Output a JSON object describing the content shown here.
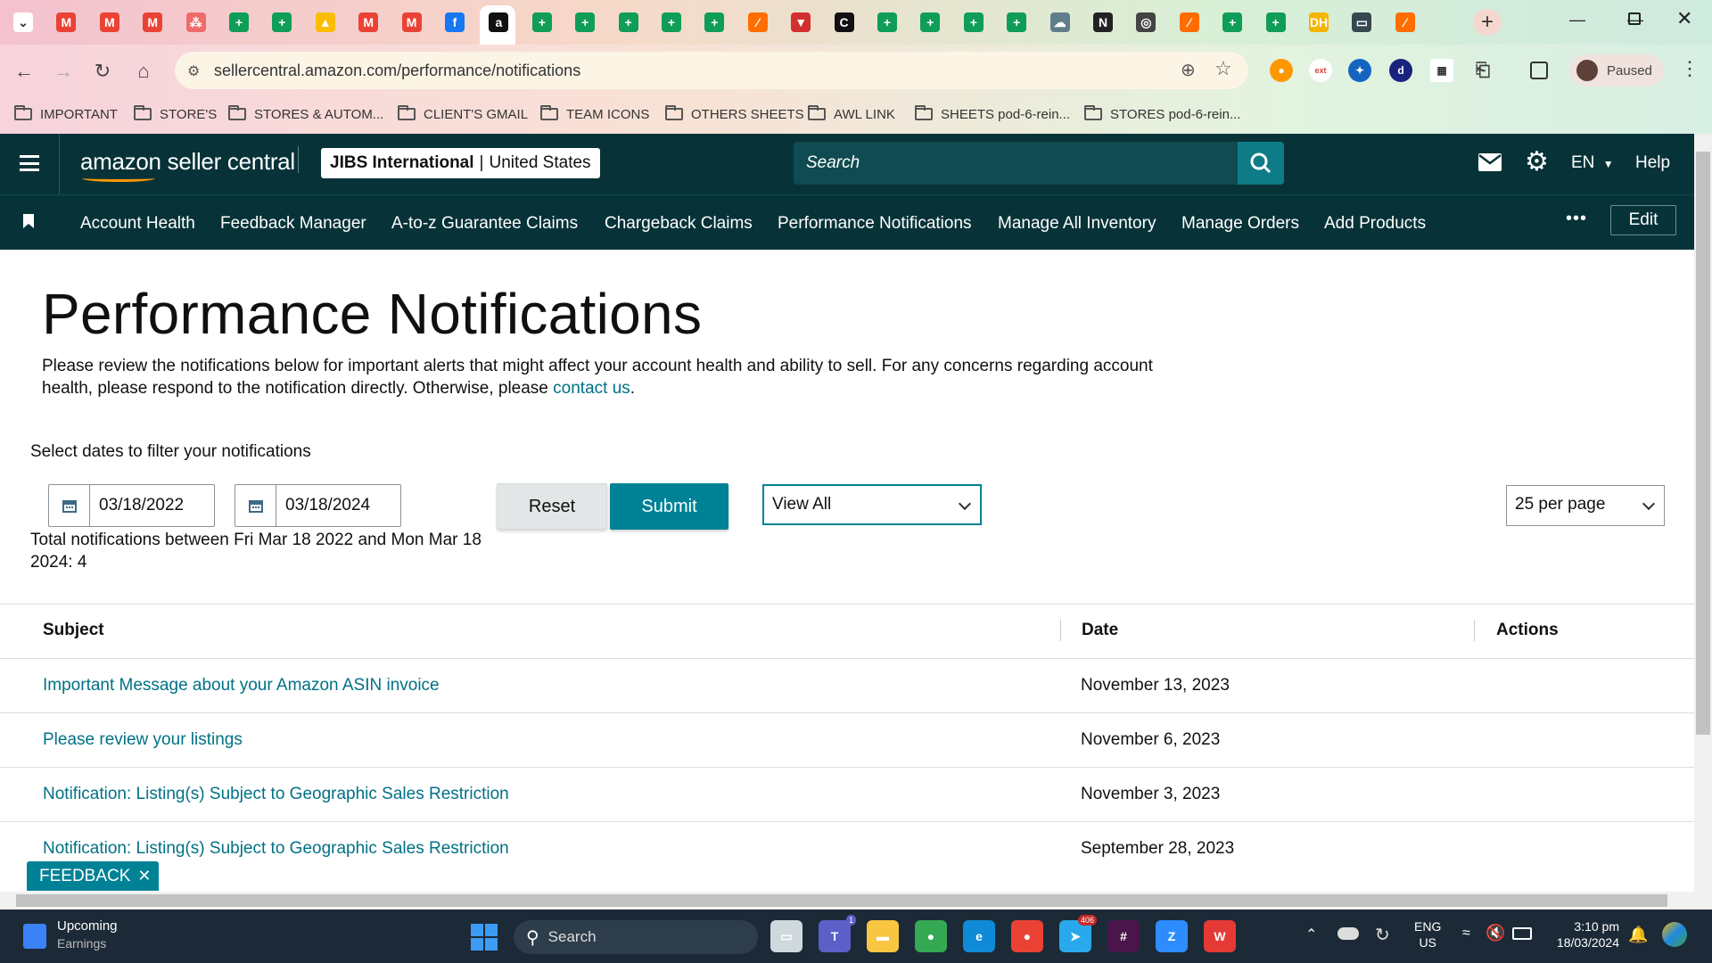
{
  "browser": {
    "url": "sellercentral.amazon.com/performance/notifications",
    "profile_status": "Paused",
    "tabs": [
      {
        "icon": "chevron-down-icon",
        "color": "#ffffff"
      },
      {
        "icon": "gmail-icon",
        "color": "#ea4335"
      },
      {
        "icon": "gmail-icon",
        "color": "#ea4335"
      },
      {
        "icon": "gmail-icon",
        "color": "#ea4335"
      },
      {
        "icon": "asana-icon",
        "color": "#f06a6a"
      },
      {
        "icon": "sheets-icon",
        "color": "#0f9d58"
      },
      {
        "icon": "sheets-icon",
        "color": "#0f9d58"
      },
      {
        "icon": "drive-icon",
        "color": "#fbbc04"
      },
      {
        "icon": "gmail-icon",
        "color": "#ea4335"
      },
      {
        "icon": "gmail-icon",
        "color": "#ea4335"
      },
      {
        "icon": "facebook-icon",
        "color": "#1877f2"
      },
      {
        "icon": "amazon-icon",
        "color": "#111111"
      },
      {
        "icon": "sheets-icon",
        "color": "#0f9d58"
      },
      {
        "icon": "sheets-icon",
        "color": "#0f9d58"
      },
      {
        "icon": "sheets-icon",
        "color": "#0f9d58"
      },
      {
        "icon": "sheets-icon",
        "color": "#0f9d58"
      },
      {
        "icon": "sheets-icon",
        "color": "#0f9d58"
      },
      {
        "icon": "zapier-icon",
        "color": "#ff6d00"
      },
      {
        "icon": "filter-icon",
        "color": "#d32f2f"
      },
      {
        "icon": "c-icon",
        "color": "#111111"
      },
      {
        "icon": "sheets-icon",
        "color": "#0f9d58"
      },
      {
        "icon": "sheets-icon",
        "color": "#0f9d58"
      },
      {
        "icon": "sheets-icon",
        "color": "#0f9d58"
      },
      {
        "icon": "sheets-icon",
        "color": "#0f9d58"
      },
      {
        "icon": "cloud-icon",
        "color": "#607d8b"
      },
      {
        "icon": "n-icon",
        "color": "#222222"
      },
      {
        "icon": "circle-icon",
        "color": "#444444"
      },
      {
        "icon": "zapier-icon",
        "color": "#ff6d00"
      },
      {
        "icon": "sheets-icon",
        "color": "#0f9d58"
      },
      {
        "icon": "sheets-icon",
        "color": "#0f9d58"
      },
      {
        "icon": "dh-icon",
        "color": "#f4b400"
      },
      {
        "icon": "window-icon",
        "color": "#37474f"
      },
      {
        "icon": "zapier-icon",
        "color": "#ff6d00"
      }
    ],
    "bookmarks": [
      "IMPORTANT",
      "STORE'S",
      "STORES & AUTOM...",
      "CLIENT'S GMAIL",
      "TEAM ICONS",
      "OTHERS SHEETS",
      "AWL LINK",
      "SHEETS pod-6-rein...",
      "STORES pod-6-rein..."
    ]
  },
  "header": {
    "logo_text": "amazon seller central",
    "store_name": "JIBS International",
    "marketplace": "United States",
    "search_placeholder": "Search",
    "language": "EN",
    "help_label": "Help"
  },
  "nav": {
    "items": [
      "Account Health",
      "Feedback Manager",
      "A-to-z Guarantee Claims",
      "Chargeback Claims",
      "Performance Notifications",
      "Manage All Inventory",
      "Manage Orders",
      "Add Products"
    ],
    "more_label": "•••",
    "edit_label": "Edit"
  },
  "page": {
    "title": "Performance Notifications",
    "intro_text": "Please review the notifications below for important alerts that might affect your account health and ability to sell. For any concerns regarding account health, please respond to the notification directly. Otherwise, please ",
    "intro_link": "contact us",
    "intro_end": ".",
    "filter_label": "Select dates to filter your notifications",
    "start_date": "03/18/2022",
    "end_date": "03/18/2024",
    "reset_label": "Reset",
    "submit_label": "Submit",
    "view_filter": "View All",
    "per_page": "25 per page",
    "total_text": "Total notifications between Fri Mar 18 2022 and Mon Mar 18 2024: 4"
  },
  "table": {
    "columns": [
      "Subject",
      "Date",
      "Actions"
    ],
    "rows": [
      {
        "subject": "Important Message about your Amazon ASIN invoice",
        "date": "November 13, 2023"
      },
      {
        "subject": "Please review your listings",
        "date": "November 6, 2023"
      },
      {
        "subject": "Notification: Listing(s) Subject to Geographic Sales Restriction",
        "date": "November 3, 2023"
      },
      {
        "subject": "Notification: Listing(s) Subject to Geographic Sales Restriction",
        "date": "September 28, 2023"
      }
    ]
  },
  "feedback_label": "FEEDBACK",
  "taskbar": {
    "widget_title": "Upcoming",
    "widget_subtitle": "Earnings",
    "search_label": "Search",
    "teams_badge": "1",
    "telegram_badge": "406",
    "lang_top": "ENG",
    "lang_bottom": "US",
    "time": "3:10 pm",
    "date": "18/03/2024"
  },
  "colors": {
    "amazon_header": "#073338",
    "link": "#007185",
    "submit": "#008296"
  }
}
